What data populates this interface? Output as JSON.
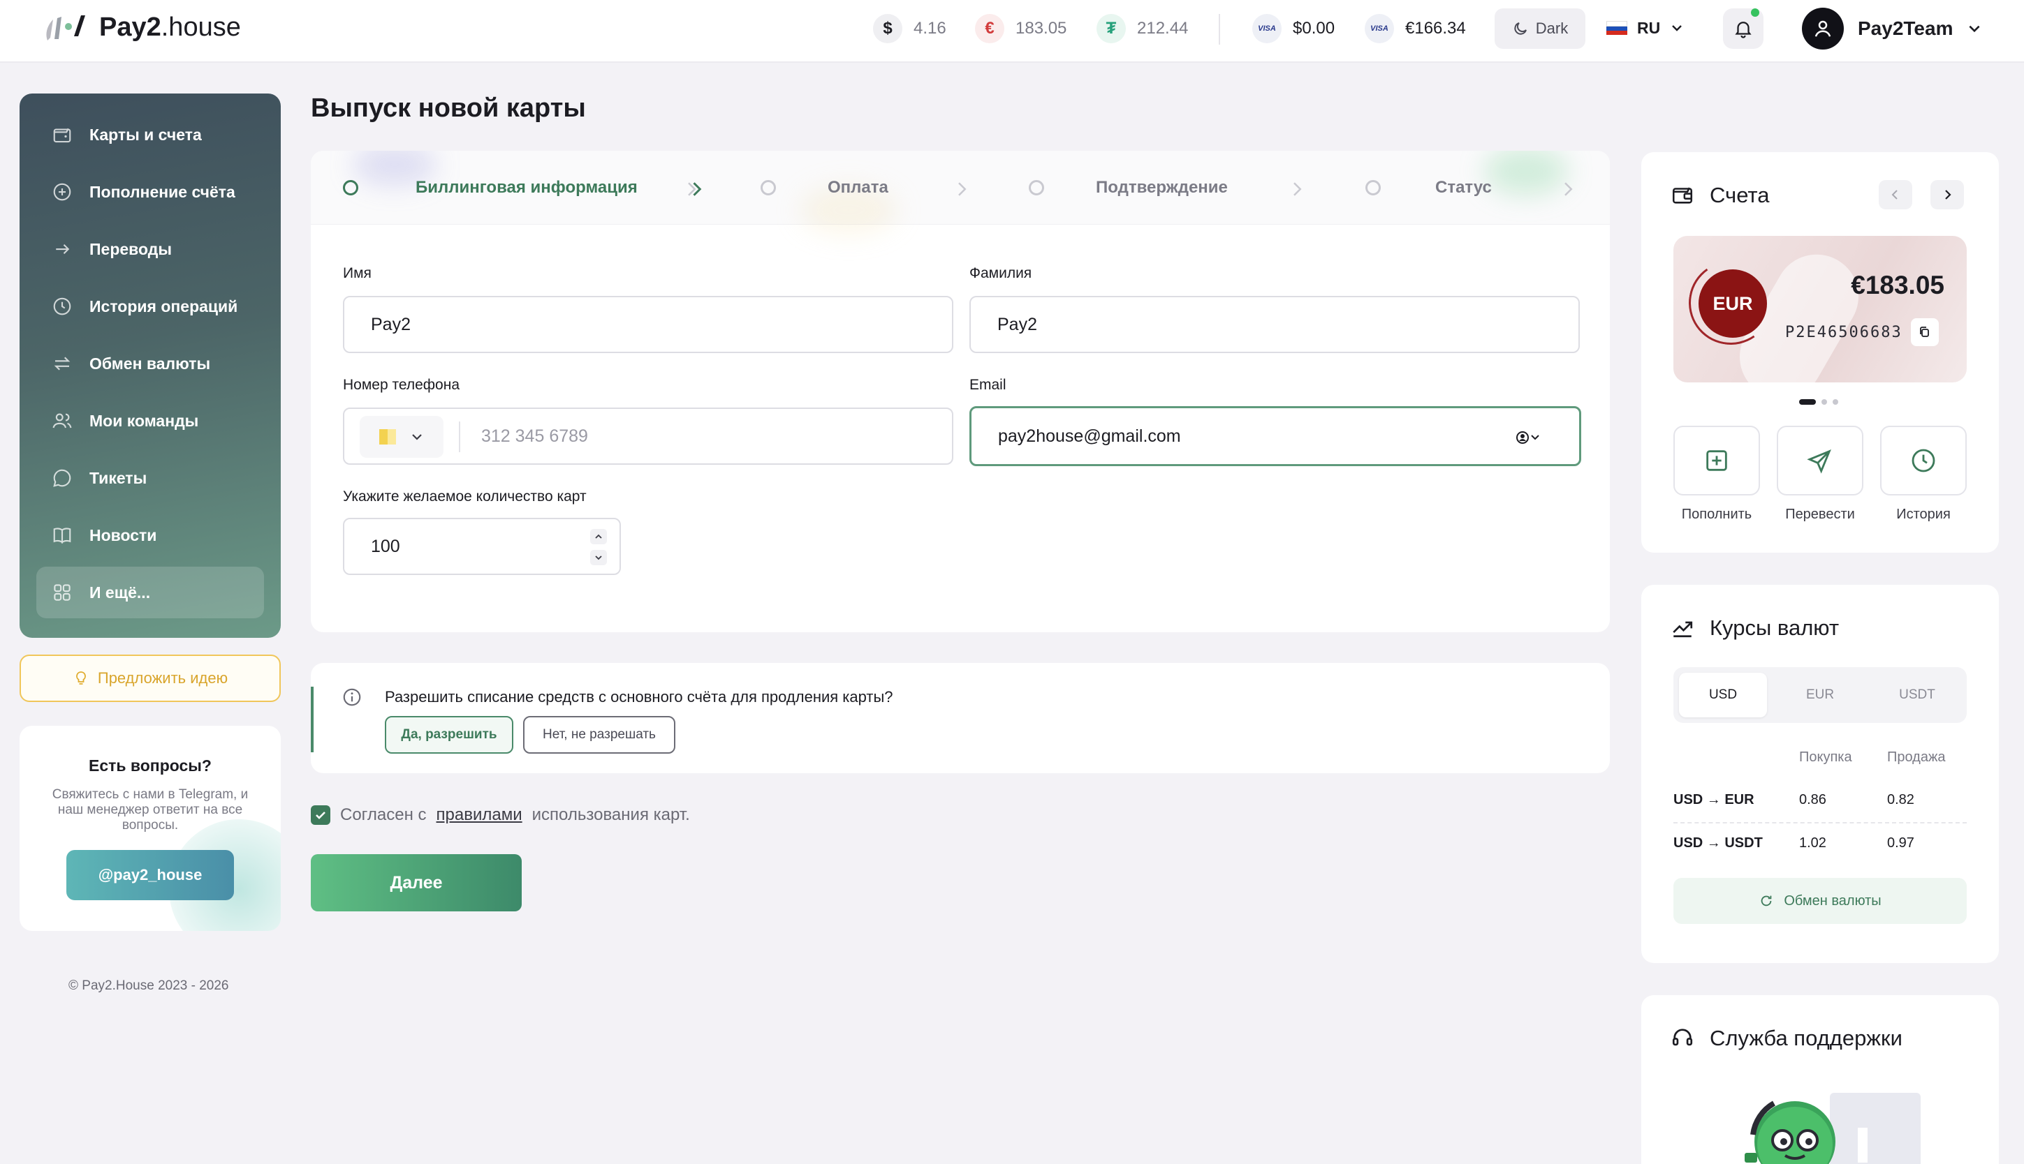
{
  "brand": {
    "name_bold": "Pay2",
    "name_light": ".house"
  },
  "topbar": {
    "balances": [
      {
        "symbol": "$",
        "value": "4.16",
        "icon": "usd-coin-icon",
        "color": "#1c1c22"
      },
      {
        "symbol": "€",
        "value": "183.05",
        "icon": "eur-coin-icon",
        "color": "#d23c3c"
      },
      {
        "symbol": "₮",
        "value": "212.44",
        "icon": "usdt-coin-icon",
        "color": "#26a17b"
      }
    ],
    "cards": [
      {
        "brand": "VISA",
        "value": "$0.00"
      },
      {
        "brand": "VISA",
        "value": "€166.34"
      }
    ],
    "theme_label": "Dark",
    "language": "RU",
    "user_name": "Pay2Team"
  },
  "sidebar": {
    "items": [
      {
        "label": "Карты и счета",
        "icon": "wallet-icon"
      },
      {
        "label": "Пополнение счёта",
        "icon": "plus-circle-icon"
      },
      {
        "label": "Переводы",
        "icon": "arrow-right-icon"
      },
      {
        "label": "История операций",
        "icon": "clock-icon"
      },
      {
        "label": "Обмен валюты",
        "icon": "exchange-icon"
      },
      {
        "label": "Мои команды",
        "icon": "users-icon"
      },
      {
        "label": "Тикеты",
        "icon": "chat-icon"
      },
      {
        "label": "Новости",
        "icon": "book-icon"
      },
      {
        "label": "И ещё...",
        "icon": "grid-icon"
      }
    ],
    "idea_label": "Предложить идею",
    "help": {
      "title": "Есть вопросы?",
      "text": "Свяжитесь с нами в Telegram, и наш менеджер ответит на все вопросы.",
      "button": "@pay2_house"
    },
    "copyright": "© Pay2.House 2023 - 2026"
  },
  "main": {
    "title": "Выпуск новой карты",
    "steps": [
      "Биллинговая информация",
      "Оплата",
      "Подтверждение",
      "Статус"
    ],
    "active_step": 0,
    "form": {
      "first_name_label": "Имя",
      "first_name_value": "Pay2",
      "last_name_label": "Фамилия",
      "last_name_value": "Pay2",
      "phone_label": "Номер телефона",
      "phone_placeholder": "312 345 6789",
      "email_label": "Email",
      "email_value": "pay2house@gmail.com",
      "count_label": "Укажите желаемое количество карт",
      "count_value": "100"
    },
    "consent": {
      "question": "Разрешить списание средств с основного счёта для продления карты?",
      "yes": "Да, разрешить",
      "no": "Нет, не разрешать"
    },
    "agree": {
      "prefix": "Согласен с",
      "link": "правилами",
      "suffix": "использования карт.",
      "checked": true
    },
    "next_label": "Далее"
  },
  "accounts": {
    "title": "Счета",
    "card": {
      "currency": "EUR",
      "amount": "€183.05",
      "number": "P2E46506683"
    },
    "actions": [
      {
        "label": "Пополнить",
        "icon": "plus-square-icon"
      },
      {
        "label": "Перевести",
        "icon": "send-icon"
      },
      {
        "label": "История",
        "icon": "clock-icon"
      }
    ]
  },
  "rates": {
    "title": "Курсы валют",
    "tabs": [
      "USD",
      "EUR",
      "USDT"
    ],
    "active_tab": 0,
    "headers": {
      "buy": "Покупка",
      "sell": "Продажа"
    },
    "rows": [
      {
        "pair": "USD → EUR",
        "buy": "0.86",
        "sell": "0.82"
      },
      {
        "pair": "USD → USDT",
        "buy": "1.02",
        "sell": "0.97"
      }
    ],
    "exchange_label": "Обмен валюты"
  },
  "support": {
    "title": "Служба поддержки"
  }
}
